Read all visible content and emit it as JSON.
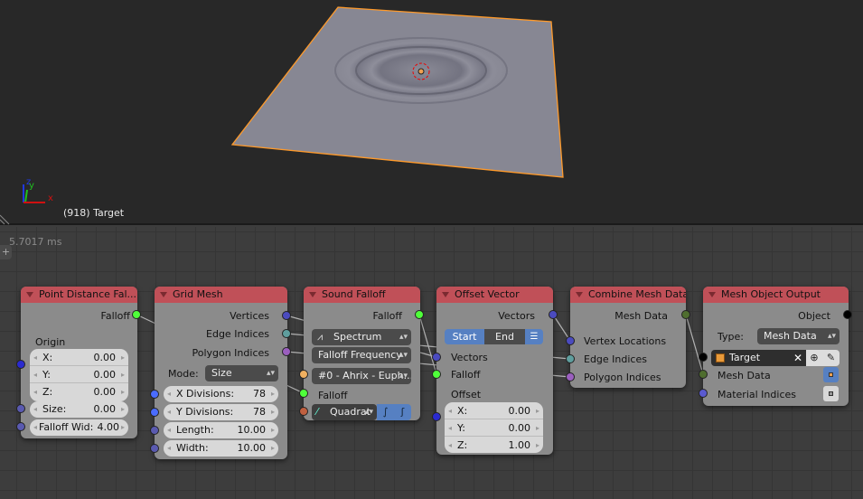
{
  "viewport": {
    "object_label": "(918) Target",
    "axis_x": "x",
    "axis_y": "y",
    "axis_z": "z"
  },
  "editor": {
    "timing": "5.7017 ms"
  },
  "colors": {
    "header": "#c05058",
    "float_socket": "#4fff3a",
    "vector_socket": "#4b4bbf",
    "edge_socket": "#5f9e9e",
    "polygon_socket": "#9b5fbf",
    "mesh_socket": "#4f6e2f",
    "object_socket": "#000000",
    "selection_outline": "#ff9a2a"
  },
  "nodes": {
    "point_distance": {
      "title": "Point Distance Fal...",
      "out_falloff": "Falloff",
      "origin": "Origin",
      "x_label": "X:",
      "x": "0.00",
      "y_label": "Y:",
      "y": "0.00",
      "z_label": "Z:",
      "z": "0.00",
      "size_label": "Size:",
      "size": "0.00",
      "width_label": "Falloff Wid:",
      "width": "4.00"
    },
    "grid_mesh": {
      "title": "Grid Mesh",
      "out_vertices": "Vertices",
      "out_edges": "Edge Indices",
      "out_polygons": "Polygon Indices",
      "mode_label": "Mode:",
      "mode": "Size",
      "xdiv_label": "X Divisions:",
      "xdiv": "78",
      "ydiv_label": "Y Divisions:",
      "ydiv": "78",
      "length_label": "Length:",
      "length": "10.00",
      "width_label": "Width:",
      "width": "10.00"
    },
    "sound_falloff": {
      "title": "Sound Falloff",
      "out_falloff": "Falloff",
      "type": "Spectrum",
      "mode": "Falloff Frequency",
      "sound": "#0 - Ahrix - Euph...",
      "in_falloff": "Falloff",
      "interpolation": "Quadrat"
    },
    "offset_vector": {
      "title": "Offset Vector",
      "out_vectors": "Vectors",
      "start": "Start",
      "end": "End",
      "in_vectors": "Vectors",
      "in_falloff": "Falloff",
      "offset": "Offset",
      "x_label": "X:",
      "x": "0.00",
      "y_label": "Y:",
      "y": "0.00",
      "z_label": "Z:",
      "z": "1.00"
    },
    "combine_mesh": {
      "title": "Combine Mesh Data",
      "out_mesh": "Mesh Data",
      "in_vertex": "Vertex Locations",
      "in_edges": "Edge Indices",
      "in_polygons": "Polygon Indices"
    },
    "mesh_output": {
      "title": "Mesh Object Output",
      "out_object": "Object",
      "type_label": "Type:",
      "type": "Mesh Data",
      "target": "Target",
      "in_mesh": "Mesh Data",
      "in_material": "Material Indices"
    }
  }
}
